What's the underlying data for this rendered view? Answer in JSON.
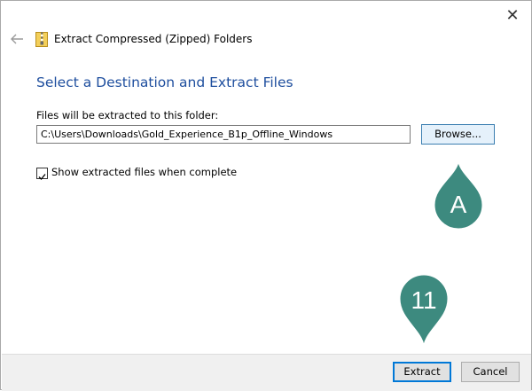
{
  "window": {
    "title": "Extract Compressed (Zipped) Folders",
    "close_label": "✕"
  },
  "main": {
    "heading": "Select a Destination and Extract Files",
    "path_label": "Files will be extracted to this folder:",
    "path_value": "C:\\Users\\Downloads\\Gold_Experience_B1p_Offline_Windows",
    "browse_label": "Browse...",
    "show_files_checked": true,
    "show_files_label": "Show extracted files when complete"
  },
  "footer": {
    "extract_label": "Extract",
    "cancel_label": "Cancel"
  },
  "callouts": {
    "browse_marker": "A",
    "extract_marker": "11",
    "color": "#3d8a7f"
  },
  "colors": {
    "heading": "#1e4e9e",
    "browse_highlight": "#e5f1fb",
    "default_button_border": "#0078d7"
  }
}
